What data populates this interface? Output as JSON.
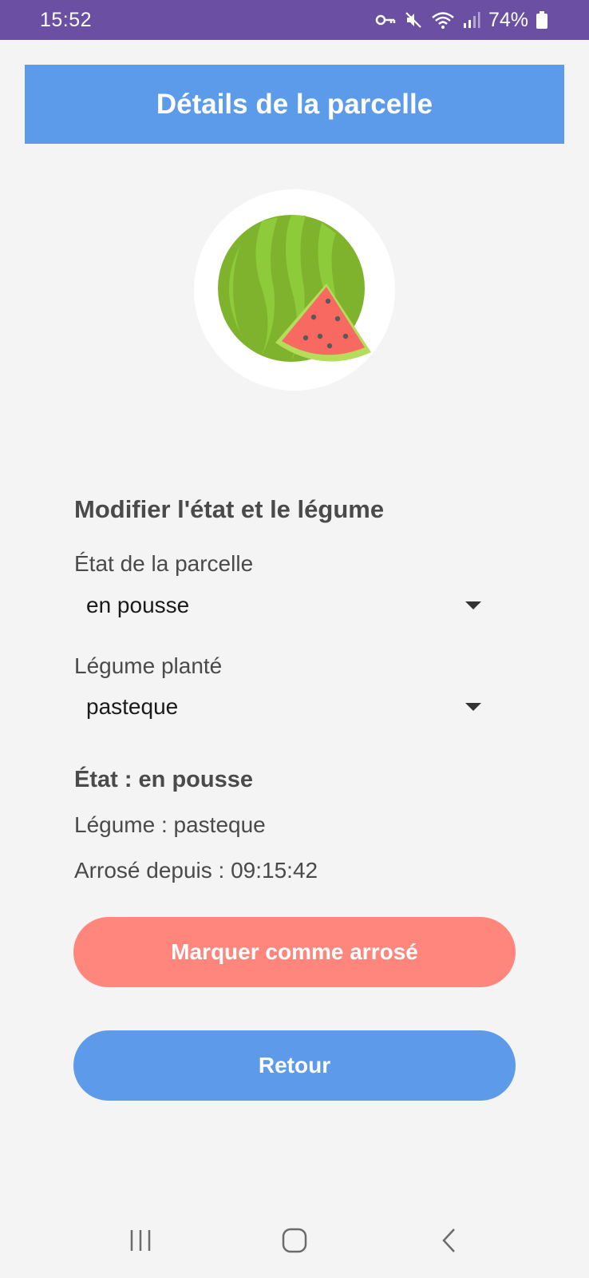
{
  "status_bar": {
    "time": "15:52",
    "battery": "74%",
    "icons": [
      "key-icon",
      "mute-icon",
      "wifi-icon",
      "signal-icon",
      "battery-icon"
    ]
  },
  "header": {
    "title": "Détails de la parcelle",
    "color": "#5c9bea"
  },
  "plot_image": {
    "icon": "watermelon-icon"
  },
  "form": {
    "section_title": "Modifier l'état et le légume",
    "state_label": "État de la parcelle",
    "state_value": "en pousse",
    "vegetable_label": "Légume planté",
    "vegetable_value": "pasteque"
  },
  "info": {
    "state": "État : en pousse",
    "vegetable": "Légume : pasteque",
    "watered_since": "Arrosé depuis : 09:15:42"
  },
  "buttons": {
    "water_label": "Marquer comme arrosé",
    "water_color": "#fe867d",
    "back_label": "Retour",
    "back_color": "#5d9bea"
  },
  "nav_bar": {
    "icons": [
      "recent-apps-icon",
      "home-icon",
      "back-icon"
    ]
  }
}
